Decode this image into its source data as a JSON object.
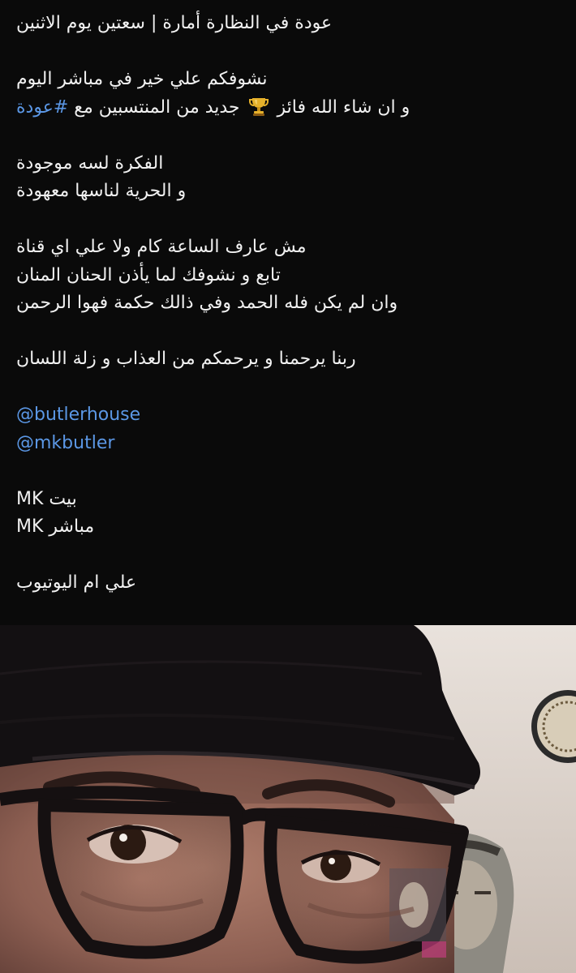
{
  "post": {
    "title_line": "عودة في النظارة أمارة | سعتين يوم الاثنين",
    "p1_line1": "نشوفكم علي خير في مباشر اليوم",
    "p1_line2_part1": "و ان شاء الله فائز",
    "trophy_emoji": "trophy-icon",
    "p1_line2_part2": "جديد من المنتسبين مع",
    "hashtag": "#عودة",
    "p2_line1": "الفكرة لسه موجودة",
    "p2_line2": "و الحرية لناسها معهودة",
    "p3_line1": "مش عارف الساعة كام ولا علي اي قناة",
    "p3_line2": "تابع و نشوفك لما يأذن الحنان المنان",
    "p3_line3": "وان لم يكن فله الحمد وفي ذالك حكمة فهوا الرحمن",
    "p4_line1": "ربنا يرحمنا و يرحمكم من العذاب و زلة اللسان",
    "mention1": "@butlerhouse",
    "mention2": "@mkbutler",
    "p6_line1": "بيت MK",
    "p6_line2": "مباشر MK",
    "p7_line1": "علي ام اليوتيوب"
  },
  "colors": {
    "background": "#0a0a0a",
    "text": "#f1f1f1",
    "link": "#5b97e5"
  },
  "photo": {
    "icon": "selfie-photo"
  }
}
